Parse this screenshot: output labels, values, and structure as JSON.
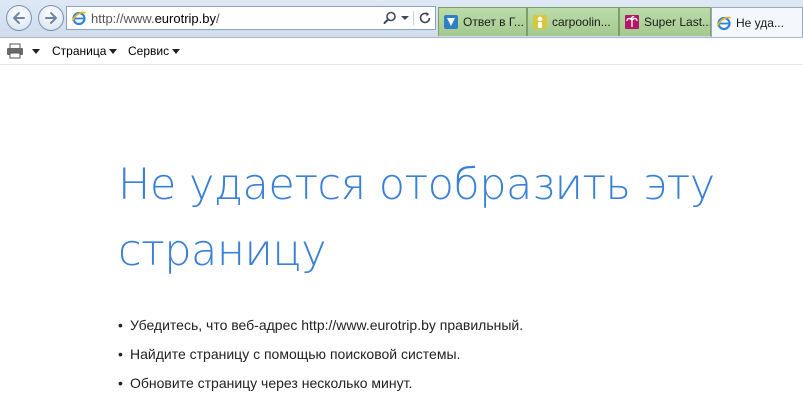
{
  "browser": {
    "address": {
      "scheme": "http://www.",
      "host": "eurotrip.by",
      "path": "/"
    },
    "tabs": [
      {
        "title": "Ответ в Г...",
        "icon": "bookmark-icon",
        "width": 89
      },
      {
        "title": "carpoolin...",
        "icon": "person-icon",
        "width": 92
      },
      {
        "title": "Super Last...",
        "icon": "palm-icon",
        "width": 92
      },
      {
        "title": "Не уда...",
        "icon": "ie-icon",
        "width": 92
      }
    ],
    "command_bar": {
      "page_menu": "Страница",
      "tools_menu": "Сервис"
    },
    "accent_color": "#3a80d6"
  },
  "error_page": {
    "title": "Не удается отобразить эту страницу",
    "suggestions": [
      "Убедитесь, что веб-адрес http://www.eurotrip.by правильный.",
      "Найдите страницу с помощью поисковой системы.",
      "Обновите страницу через несколько минут."
    ]
  }
}
